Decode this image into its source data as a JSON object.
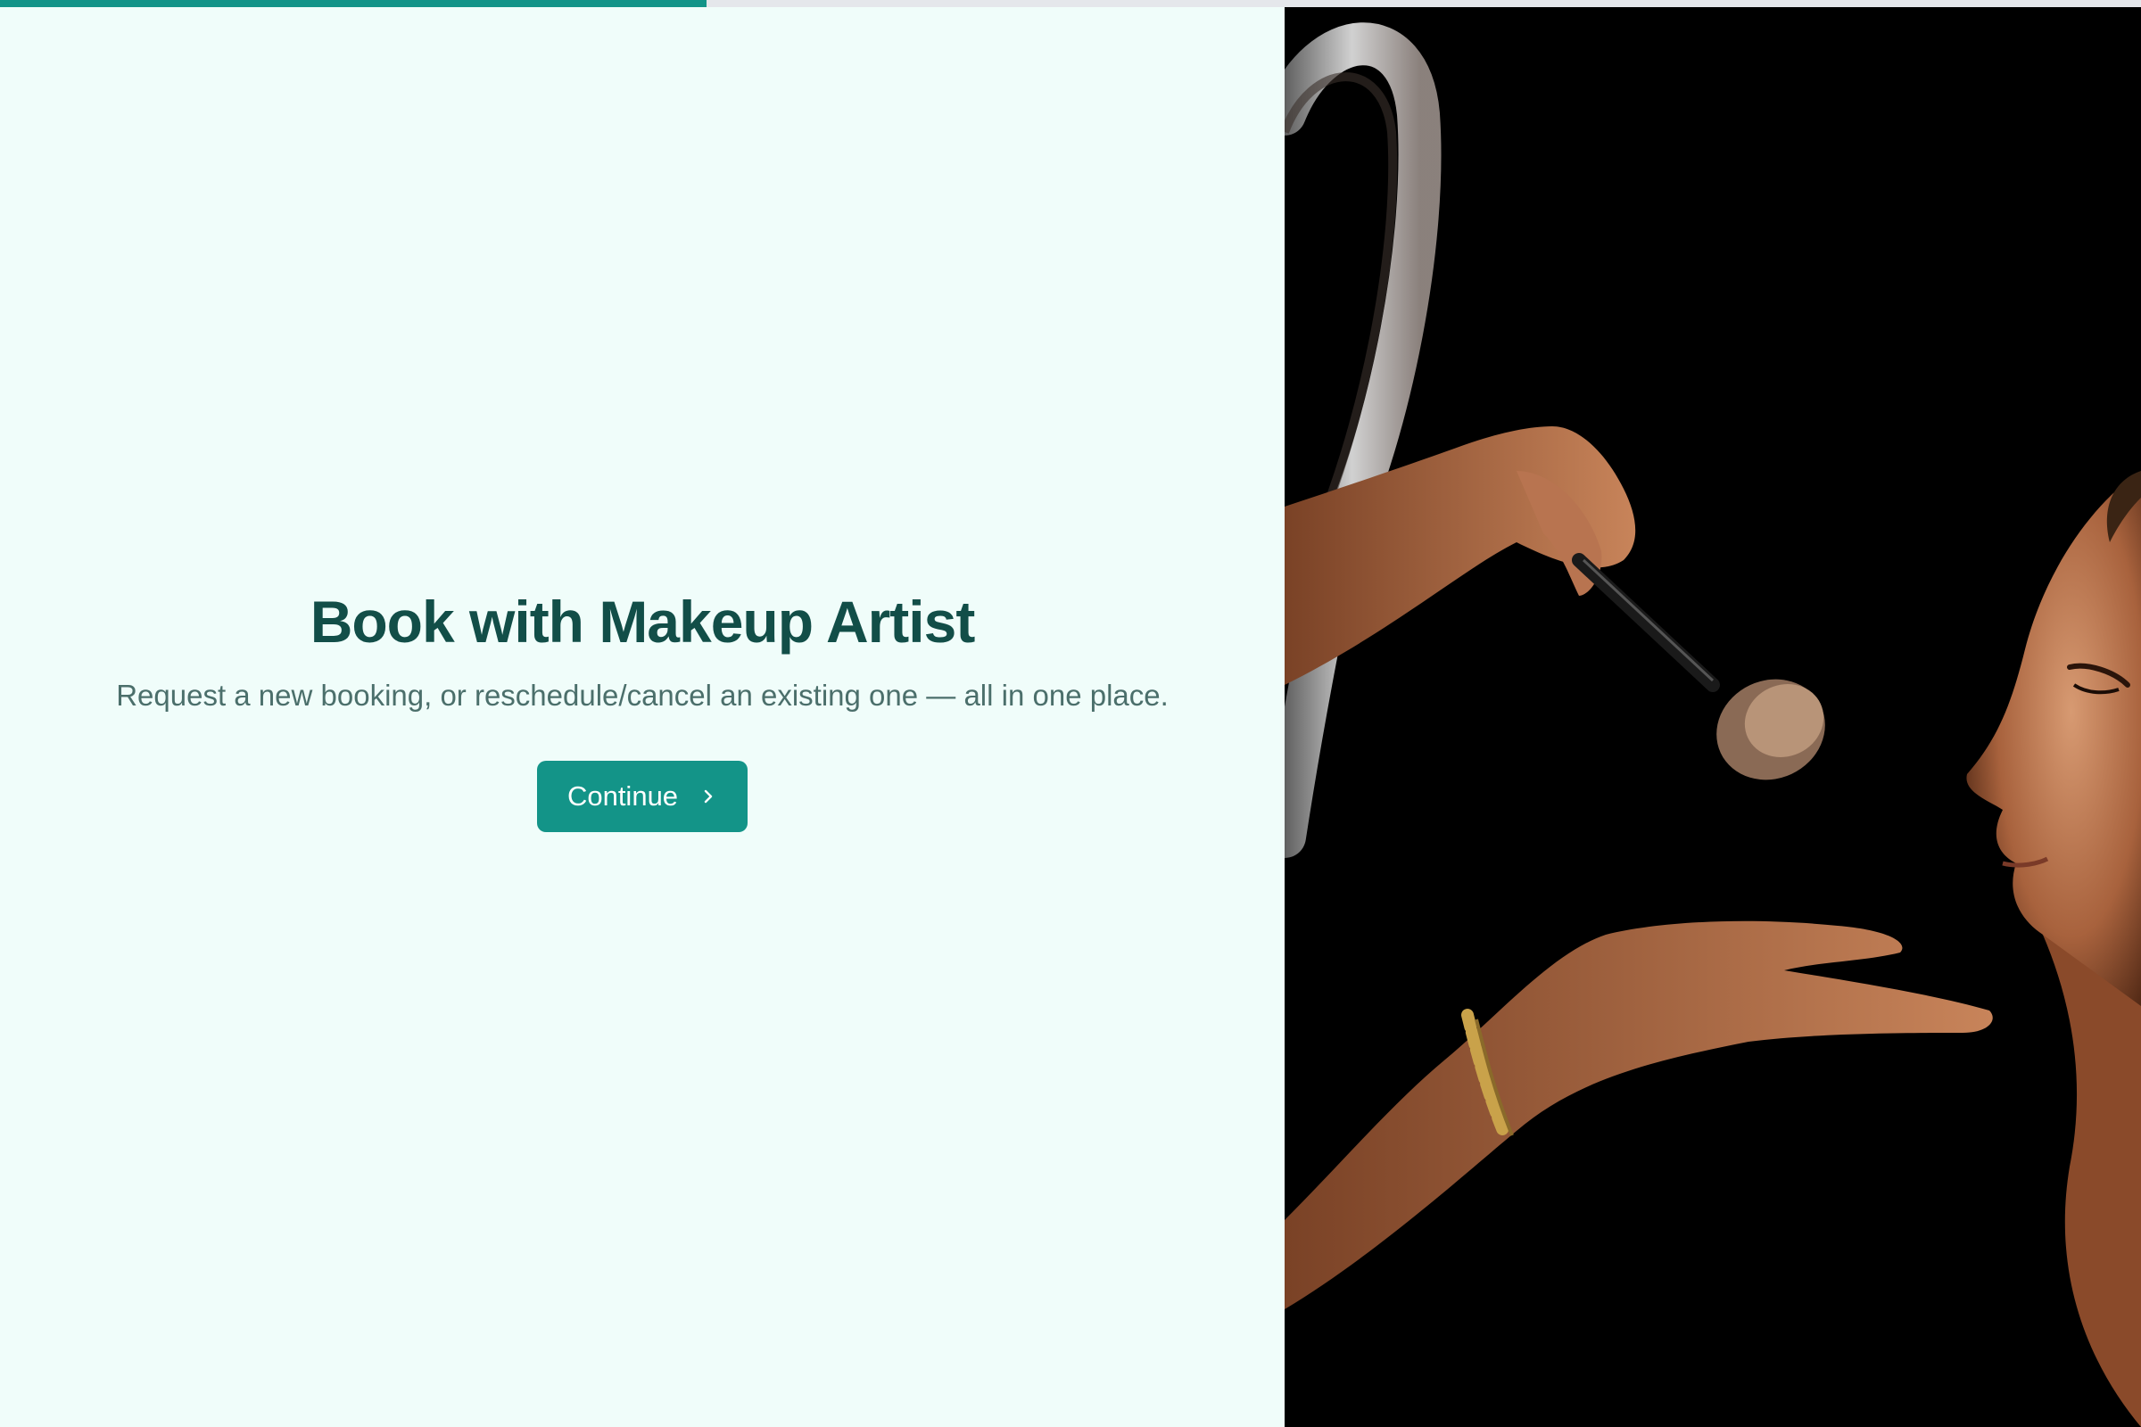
{
  "progress": {
    "fraction": 0.33,
    "color": "#139488"
  },
  "hero": {
    "title": "Book with Makeup Artist",
    "subtitle": "Request a new booking, or reschedule/cancel an existing one — all in one place.",
    "continue_label": "Continue"
  },
  "colors": {
    "background": "#f0fdfa",
    "accent": "#139488",
    "title": "#124e48",
    "subtitle": "#4b6f6b"
  },
  "icons": {
    "continue_icon": "chevron-right-icon"
  },
  "image": {
    "subject": "makeup artist applying powder brush to woman's face"
  }
}
